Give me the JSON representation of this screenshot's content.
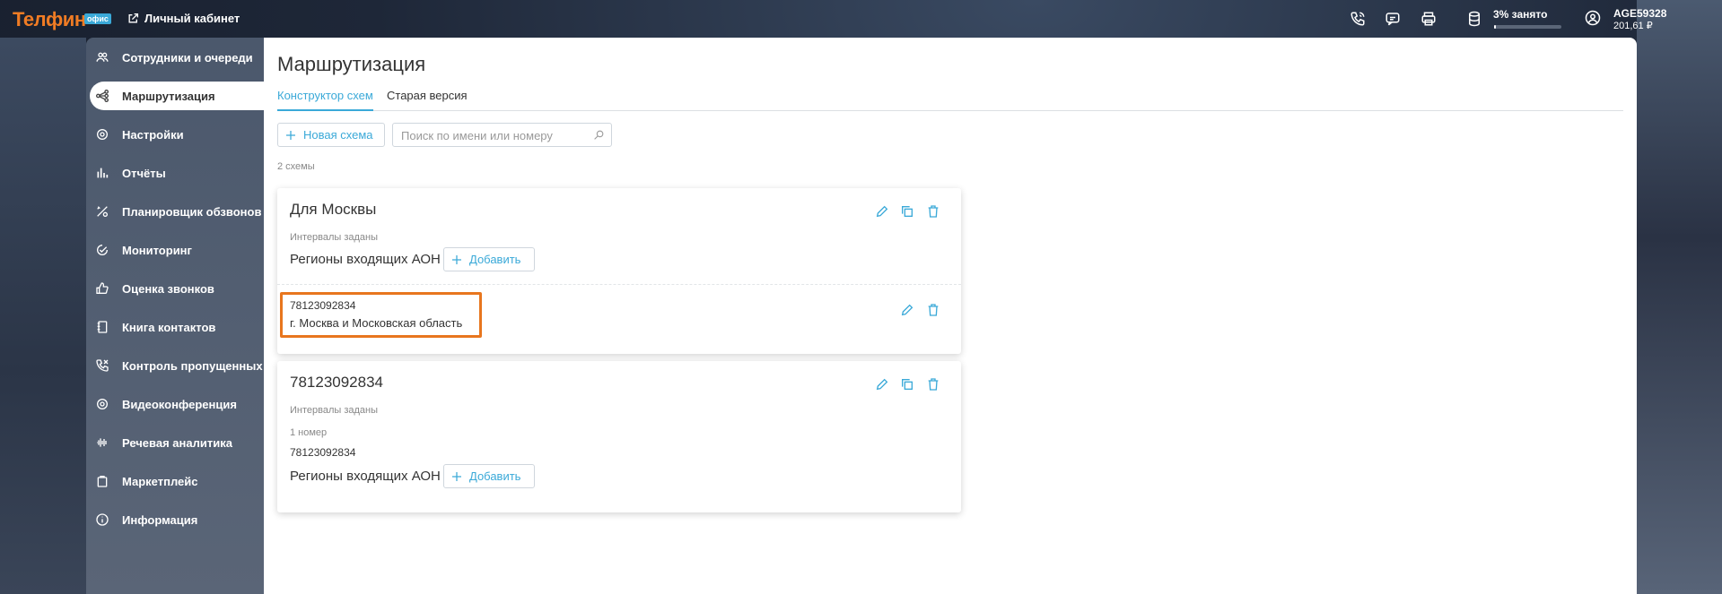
{
  "topbar": {
    "logo": "Телфин",
    "logo_badge": "офис",
    "cabinet_link": "Личный кабинет",
    "storage_text": "3% занято",
    "storage_percent": 3,
    "user_id": "AGE59328",
    "balance": "201,61 ₽",
    "icons": [
      "phone-icon",
      "chat-icon",
      "printer-icon",
      "database-icon",
      "user-circle-icon"
    ]
  },
  "sidebar": {
    "items": [
      {
        "label": "Сотрудники и очереди",
        "icon": "users-icon"
      },
      {
        "label": "Маршрутизация",
        "icon": "routing-icon",
        "active": true
      },
      {
        "label": "Настройки",
        "icon": "settings-icon"
      },
      {
        "label": "Отчёты",
        "icon": "bar-chart-icon"
      },
      {
        "label": "Планировщик обзвонов",
        "icon": "scheduler-icon"
      },
      {
        "label": "Мониторинг",
        "icon": "monitoring-icon"
      },
      {
        "label": "Оценка звонков",
        "icon": "thumb-up-icon"
      },
      {
        "label": "Книга контактов",
        "icon": "book-icon"
      },
      {
        "label": "Контроль пропущенных",
        "icon": "missed-call-icon"
      },
      {
        "label": "Видеоконференция",
        "icon": "video-icon"
      },
      {
        "label": "Речевая аналитика",
        "icon": "waveform-icon"
      },
      {
        "label": "Маркетплейс",
        "icon": "bag-icon"
      },
      {
        "label": "Информация",
        "icon": "info-icon"
      }
    ]
  },
  "main": {
    "title": "Маршрутизация",
    "tabs": [
      {
        "label": "Конструктор схем",
        "active": true
      },
      {
        "label": "Старая версия",
        "active": false
      }
    ],
    "new_scheme_label": "Новая схема",
    "search_placeholder": "Поиск по имени или номеру",
    "scheme_count": "2 схемы",
    "cards": [
      {
        "title": "Для Москвы",
        "intervals": "Интервалы заданы",
        "regions_label": "Регионы входящих АОН",
        "add_label": "Добавить",
        "region": {
          "number": "78123092834",
          "name": "г. Москва и Московская область"
        }
      },
      {
        "title": "78123092834",
        "intervals": "Интервалы заданы",
        "numbers_count": "1 номер",
        "number": "78123092834",
        "regions_label": "Регионы входящих АОН",
        "add_label": "Добавить"
      }
    ]
  },
  "colors": {
    "accent": "#3aa9d8",
    "brand": "#f07c24",
    "highlight": "#e8761e"
  }
}
